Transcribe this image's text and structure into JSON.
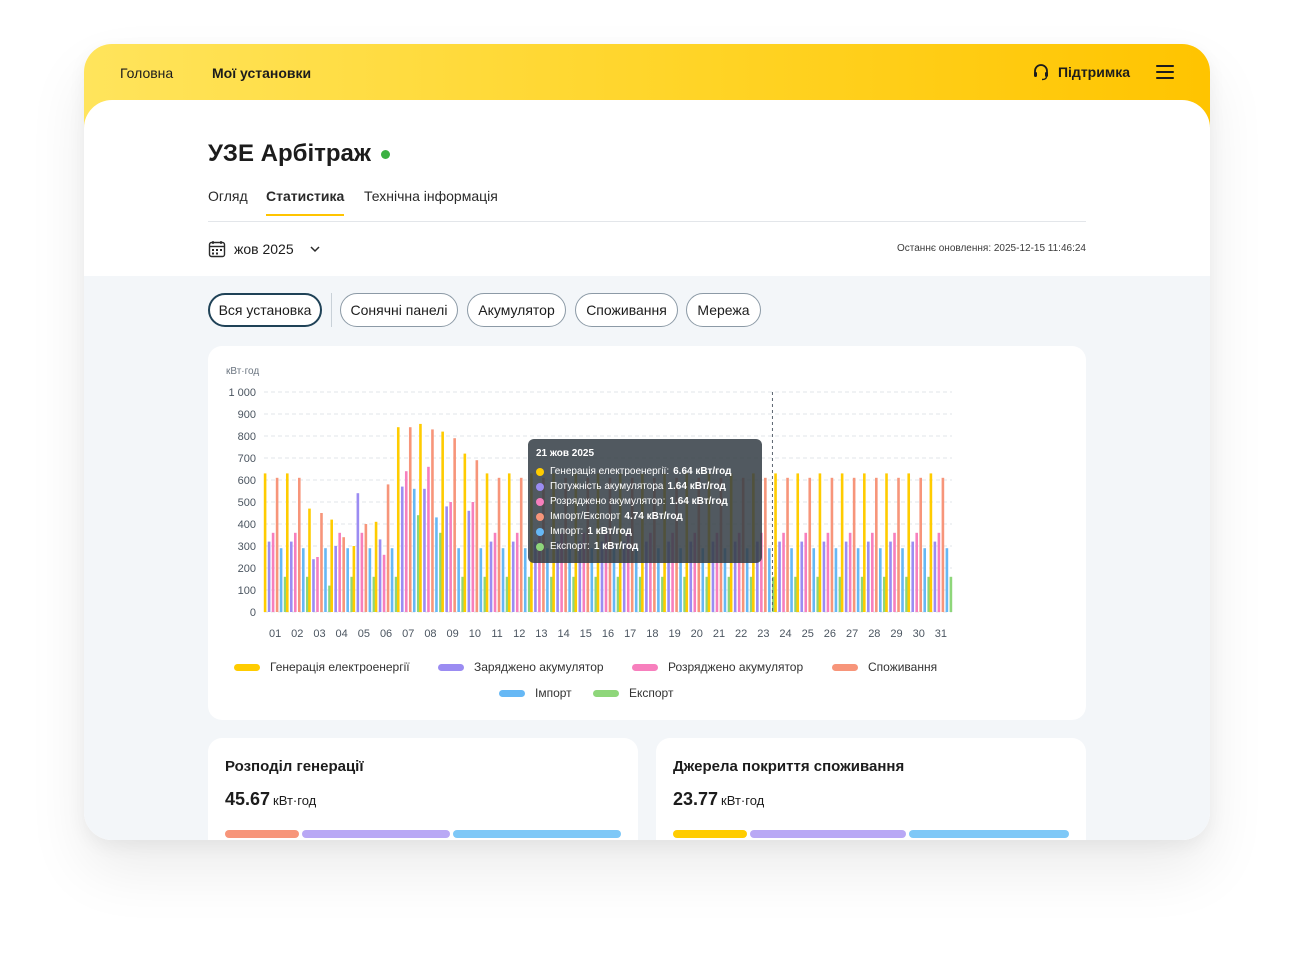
{
  "nav": {
    "home": "Головна",
    "installations": "Мої установки",
    "support": "Підтримка"
  },
  "page": {
    "title": "УЗЕ Арбітраж",
    "status_color": "#3cb043",
    "tabs": [
      "Огляд",
      "Статистика",
      "Технічна інформація"
    ],
    "active_tab": "Статистика",
    "month": "жов 2025",
    "last_updated": "Останнє оновлення: 2025-12-15 11:46:24"
  },
  "filters": [
    "Вся установка",
    "Сонячні панелі",
    "Акумулятор",
    "Споживання",
    "Мережа"
  ],
  "active_filter": "Вся установка",
  "colors": {
    "generation": "#ffcc00",
    "battery_charged": "#9b8cf2",
    "battery_discharged": "#f77fbd",
    "consumption": "#f7957a",
    "import": "#66b8f5",
    "export": "#8ed67a",
    "accent": "#ffc400"
  },
  "chart_data": {
    "type": "bar",
    "ylabel": "кВт·год",
    "ylim": [
      0,
      1000
    ],
    "yticks": [
      "1 000",
      "900",
      "800",
      "700",
      "600",
      "500",
      "400",
      "300",
      "200",
      "100",
      "0"
    ],
    "categories": [
      "01",
      "02",
      "03",
      "04",
      "05",
      "06",
      "07",
      "08",
      "09",
      "10",
      "11",
      "12",
      "13",
      "14",
      "15",
      "16",
      "17",
      "18",
      "19",
      "20",
      "21",
      "22",
      "23",
      "24",
      "25",
      "26",
      "27",
      "28",
      "29",
      "30",
      "31"
    ],
    "series": [
      {
        "name": "Генерація електроенергії",
        "values": [
          630,
          630,
          470,
          420,
          300,
          410,
          840,
          855,
          820,
          720,
          630,
          630,
          630,
          630,
          630,
          630,
          630,
          630,
          630,
          630,
          630,
          630,
          630,
          630,
          630,
          630,
          630,
          630,
          630,
          630,
          630
        ]
      },
      {
        "name": "Заряджено акумулятор",
        "values": [
          320,
          320,
          240,
          300,
          540,
          330,
          570,
          560,
          480,
          460,
          320,
          320,
          320,
          320,
          320,
          320,
          320,
          320,
          320,
          320,
          320,
          320,
          320,
          320,
          320,
          320,
          320,
          320,
          320,
          320,
          320
        ]
      },
      {
        "name": "Розряджено акумулятор",
        "values": [
          360,
          360,
          250,
          360,
          360,
          260,
          640,
          660,
          500,
          500,
          360,
          360,
          360,
          360,
          360,
          360,
          360,
          360,
          360,
          360,
          360,
          360,
          360,
          360,
          360,
          360,
          360,
          360,
          360,
          360,
          360
        ]
      },
      {
        "name": "Споживання",
        "values": [
          610,
          610,
          450,
          340,
          400,
          580,
          840,
          830,
          790,
          690,
          610,
          610,
          610,
          610,
          610,
          610,
          610,
          610,
          610,
          610,
          610,
          610,
          610,
          610,
          610,
          610,
          610,
          610,
          610,
          610,
          610
        ]
      },
      {
        "name": "Імпорт",
        "values": [
          290,
          290,
          290,
          290,
          290,
          290,
          560,
          430,
          290,
          290,
          290,
          290,
          290,
          290,
          290,
          290,
          290,
          290,
          290,
          290,
          290,
          290,
          290,
          290,
          290,
          290,
          290,
          290,
          290,
          290,
          290
        ]
      },
      {
        "name": "Експорт",
        "values": [
          160,
          160,
          120,
          160,
          160,
          160,
          440,
          360,
          160,
          160,
          160,
          160,
          160,
          160,
          160,
          160,
          160,
          160,
          160,
          160,
          160,
          160,
          160,
          160,
          160,
          160,
          160,
          160,
          160,
          160,
          160
        ]
      }
    ],
    "legend": [
      "Генерація електроенергії",
      "Заряджено акумулятор",
      "Розряджено акумулятор",
      "Споживання",
      "Імпорт",
      "Експорт"
    ],
    "legend_position": "bottom",
    "grid": "horizontal-dashed",
    "cursor_after_category": "23",
    "tooltip": {
      "title": "21 жов 2025",
      "rows": [
        {
          "label": "Генерація електроенергії:",
          "value": "6.64 кВт/год",
          "color": "#ffcc00"
        },
        {
          "label": "Потужність акумулятора",
          "value": "1.64 кВт/год",
          "color": "#9b8cf2"
        },
        {
          "label": "Розряджено акумулятор:",
          "value": "1.64 кВт/год",
          "color": "#f77fbd"
        },
        {
          "label": "Імпорт/Експорт",
          "value": "4.74 кВт/год",
          "color": "#f7957a"
        },
        {
          "label": "Імпорт:",
          "value": "1 кВт/год",
          "color": "#66b8f5"
        },
        {
          "label": "Експорт:",
          "value": "1 кВт/год",
          "color": "#8ed67a"
        }
      ]
    }
  },
  "stats": [
    {
      "title": "Розподіл генерації",
      "value": "45.67",
      "unit": "кВт·год",
      "segments": [
        {
          "color": "#f7957a",
          "share": 0.19
        },
        {
          "color": "#b9a8f5",
          "share": 0.38
        },
        {
          "color": "#7ec8f7",
          "share": 0.43
        }
      ]
    },
    {
      "title": "Джерела покриття споживання",
      "value": "23.77",
      "unit": "кВт·год",
      "segments": [
        {
          "color": "#ffcc00",
          "share": 0.19
        },
        {
          "color": "#b9a8f5",
          "share": 0.4
        },
        {
          "color": "#7ec8f7",
          "share": 0.41
        }
      ]
    }
  ]
}
